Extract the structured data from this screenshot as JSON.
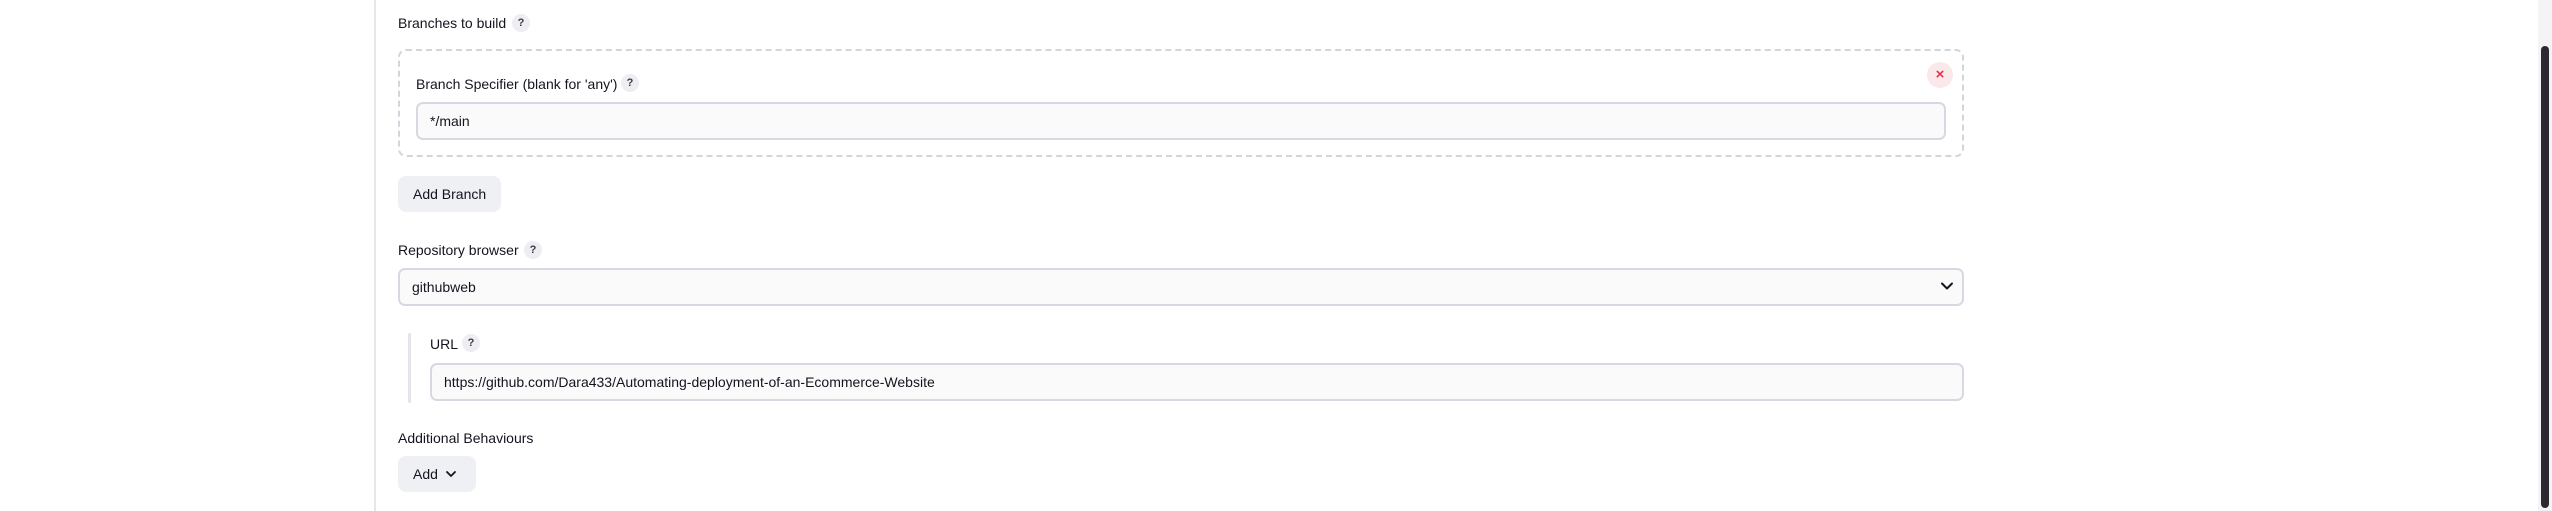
{
  "branches": {
    "label": "Branches to build",
    "help_glyph": "?",
    "remove_glyph": "×",
    "specifier": {
      "label": "Branch Specifier (blank for 'any')",
      "help_glyph": "?",
      "value": "*/main"
    },
    "add_button_label": "Add Branch"
  },
  "repository_browser": {
    "label": "Repository browser",
    "help_glyph": "?",
    "selected": "githubweb",
    "url": {
      "label": "URL",
      "help_glyph": "?",
      "value": "https://github.com/Dara433/Automating-deployment-of-an-Ecommerce-Website"
    }
  },
  "additional_behaviours": {
    "label": "Additional Behaviours",
    "add_button_label": "Add"
  },
  "icons": {
    "help": "question-mark-icon",
    "remove": "close-icon",
    "dropdown": "chevron-down-icon"
  },
  "colors": {
    "remove_accent": "#e0374d",
    "field_border": "#d8d8e2",
    "button_bg": "#eef0f4"
  }
}
